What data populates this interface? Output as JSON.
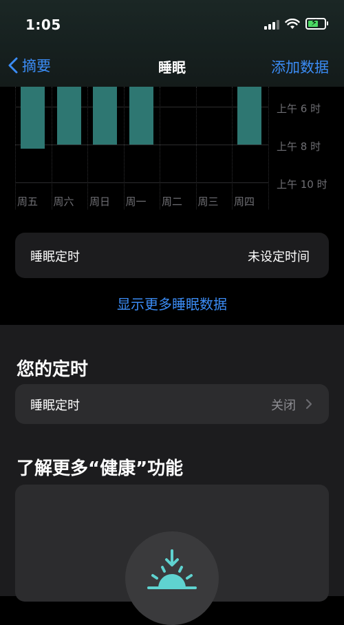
{
  "status": {
    "time": "1:05"
  },
  "nav": {
    "back_label": "摘要",
    "title": "睡眠",
    "add_label": "添加数据"
  },
  "chart_data": {
    "type": "bar",
    "categories": [
      "周五",
      "周六",
      "周日",
      "周一",
      "周二",
      "周三",
      "周四"
    ],
    "y_tick_labels": [
      "上午 6 时",
      "上午 8 时",
      "上午 10 时"
    ],
    "bar_end_hours": [
      8.2,
      8.0,
      8.0,
      8.0,
      null,
      null,
      8.0
    ],
    "bar_color": "#2e7772"
  },
  "schedule_card": {
    "label": "睡眠定时",
    "value": "未设定时间"
  },
  "more_link": "显示更多睡眠数据",
  "your_schedule": {
    "title": "您的定时",
    "row_label": "睡眠定时",
    "row_value": "关闭"
  },
  "learn_more": {
    "title": "了解更多“健康”功能"
  },
  "colors": {
    "accent": "#3b8cf5",
    "teal": "#2e7772",
    "icon_teal": "#5fd3d0"
  },
  "icons": [
    "chevron-left-icon",
    "wifi-icon",
    "battery-icon",
    "chevron-right-icon",
    "sunrise-icon"
  ]
}
